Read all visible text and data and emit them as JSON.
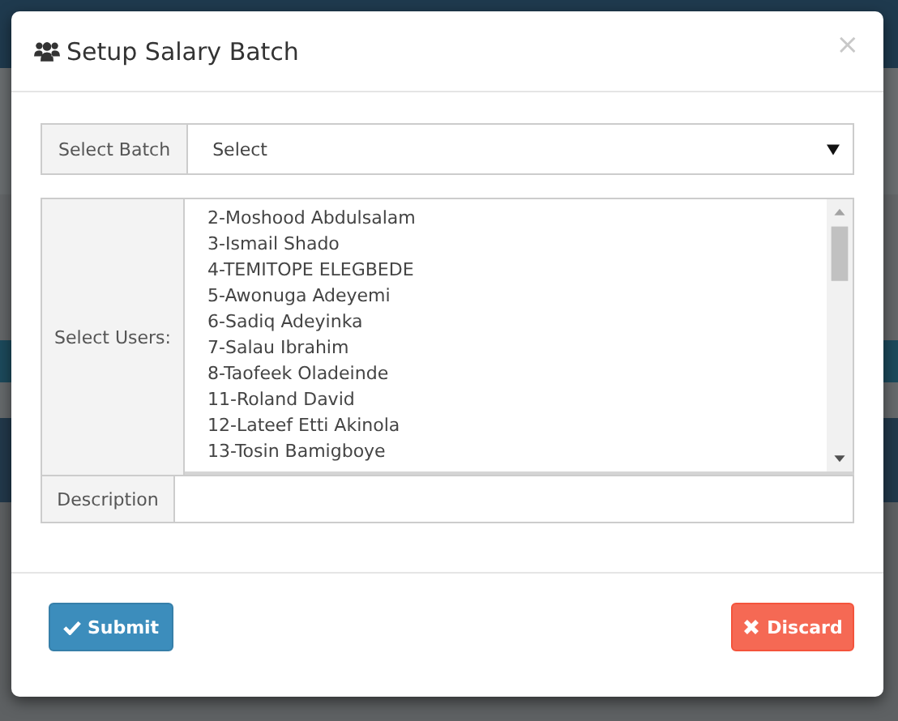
{
  "modal": {
    "title": "Setup Salary Batch",
    "close": "×"
  },
  "batch": {
    "label": "Select Batch",
    "value": "Select"
  },
  "users": {
    "label": "Select Users:",
    "options": [
      "2-Moshood Abdulsalam",
      "3-Ismail Shado",
      "4-TEMITOPE ELEGBEDE",
      "5-Awonuga Adeyemi",
      "6-Sadiq Adeyinka",
      "7-Salau Ibrahim",
      "8-Taofeek Oladeinde",
      "11-Roland David",
      "12-Lateef Etti Akinola",
      "13-Tosin Bamigboye"
    ]
  },
  "description": {
    "label": "Description"
  },
  "buttons": [
    {
      "label": "Submit",
      "kind": "submit"
    },
    {
      "label": "Discard",
      "kind": "discard"
    }
  ]
}
